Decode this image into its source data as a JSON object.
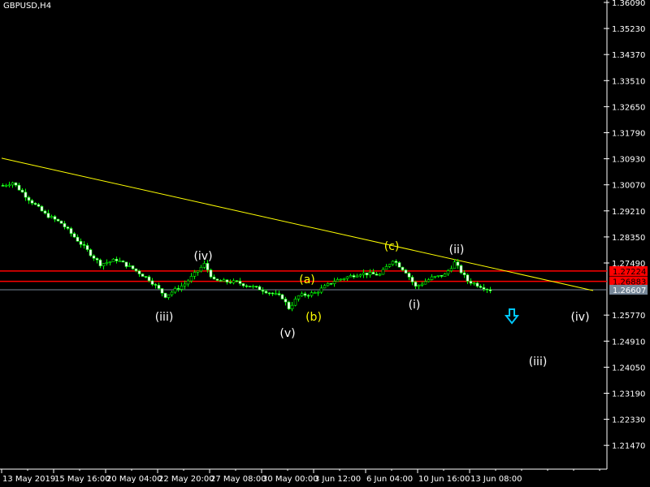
{
  "window_title": "GBPUSD,H4",
  "colors": {
    "background": "#000000",
    "axis": "#ffffff",
    "bull": "#00ff00",
    "bear": "#ffffff",
    "trendline": "#ffff00",
    "level": "#ff0000",
    "bid": "#778899",
    "arrow": "#00c8ff"
  },
  "chart_data": {
    "type": "candlestick",
    "symbol": "GBPUSD",
    "timeframe": "H4",
    "ylim": [
      1.211,
      1.3618
    ],
    "y_ticks": [
      "1.36090",
      "1.35230",
      "1.34370",
      "1.33510",
      "1.32650",
      "1.31790",
      "1.30930",
      "1.30070",
      "1.29210",
      "1.28350",
      "1.27490",
      "1.25770",
      "1.24910",
      "1.24050",
      "1.23190",
      "1.22330",
      "1.21470"
    ],
    "x_ticks": [
      "13 May 2019",
      "15 May 16:00",
      "20 May 04:00",
      "22 May 20:00",
      "27 May 08:00",
      "30 May 00:00",
      "3 Jun 12:00",
      "6 Jun 04:00",
      "10 Jun 16:00",
      "13 Jun 08:00"
    ],
    "bars_visible": 186,
    "bars_per_label": 16,
    "price_path": [
      [
        0,
        1.3005
      ],
      [
        3,
        1.3015
      ],
      [
        8,
        1.296
      ],
      [
        13,
        1.291
      ],
      [
        18,
        1.288
      ],
      [
        22,
        1.2835
      ],
      [
        26,
        1.279
      ],
      [
        30,
        1.2745
      ],
      [
        35,
        1.276
      ],
      [
        40,
        1.273
      ],
      [
        45,
        1.2695
      ],
      [
        50,
        1.264
      ],
      [
        56,
        1.268
      ],
      [
        62,
        1.2745
      ],
      [
        65,
        1.269
      ],
      [
        72,
        1.2685
      ],
      [
        80,
        1.266
      ],
      [
        86,
        1.2635
      ],
      [
        88,
        1.26
      ],
      [
        91,
        1.264
      ],
      [
        96,
        1.265
      ],
      [
        102,
        1.269
      ],
      [
        110,
        1.2715
      ],
      [
        116,
        1.271
      ],
      [
        120,
        1.276
      ],
      [
        124,
        1.272
      ],
      [
        127,
        1.267
      ],
      [
        132,
        1.27
      ],
      [
        136,
        1.271
      ],
      [
        139,
        1.275
      ],
      [
        143,
        1.269
      ],
      [
        150,
        1.266
      ]
    ],
    "levels": [
      {
        "price": 1.27224,
        "label": "1.27224",
        "type": "resistance"
      },
      {
        "price": 1.26883,
        "label": "1.26883",
        "type": "resistance"
      }
    ],
    "bid": {
      "price": 1.26607,
      "label": "1.26607"
    },
    "trendline": {
      "from": [
        0,
        1.3095
      ],
      "to": [
        182,
        1.2658
      ]
    },
    "annotations": [
      {
        "text": "(iv)",
        "bar": 62,
        "price": 1.2773,
        "color": "white"
      },
      {
        "text": "(iii)",
        "bar": 50,
        "price": 1.2572,
        "color": "white"
      },
      {
        "text": "(v)",
        "bar": 88,
        "price": 1.2518,
        "color": "white"
      },
      {
        "text": "(a)",
        "bar": 94,
        "price": 1.2695,
        "color": "yellow"
      },
      {
        "text": "(b)",
        "bar": 96,
        "price": 1.2572,
        "color": "yellow"
      },
      {
        "text": "(c)",
        "bar": 120,
        "price": 1.2805,
        "color": "yellow"
      },
      {
        "text": "(i)",
        "bar": 127,
        "price": 1.2612,
        "color": "white"
      },
      {
        "text": "(ii)",
        "bar": 140,
        "price": 1.2794,
        "color": "white"
      },
      {
        "text": "(iii)",
        "bar": 165,
        "price": 1.2425,
        "color": "white"
      },
      {
        "text": "(iv)",
        "bar": 178,
        "price": 1.2572,
        "color": "white"
      }
    ],
    "arrow": {
      "direction": "down",
      "bar": 157,
      "price": 1.2564
    }
  }
}
